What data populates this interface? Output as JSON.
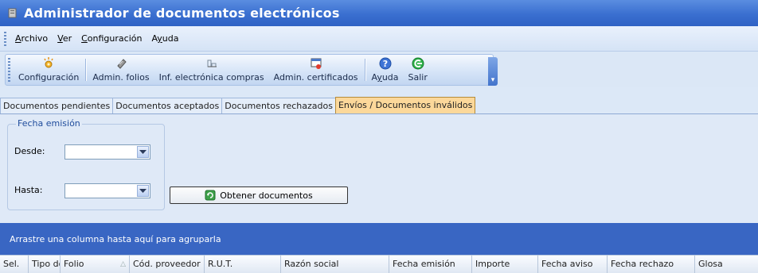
{
  "window": {
    "title": "Administrador de documentos electrónicos",
    "icon": "document-manager-icon"
  },
  "menu": [
    {
      "pre": "",
      "u": "A",
      "post": "rchivo"
    },
    {
      "pre": "",
      "u": "V",
      "post": "er"
    },
    {
      "pre": "",
      "u": "C",
      "post": "onfiguración"
    },
    {
      "pre": "A",
      "u": "y",
      "post": "uda"
    }
  ],
  "toolbar": {
    "configuracion": {
      "label": "Configuración",
      "icon": "gear-sparkle-icon"
    },
    "admin_folios": {
      "label": "Admin. folios",
      "icon": "stamp-icon"
    },
    "inf_electronica": {
      "label": "Inf. electrónica compras",
      "icon": "report-icon"
    },
    "admin_certificados": {
      "label": "Admin. certificados",
      "icon": "certificate-icon"
    },
    "ayuda": {
      "pre": "A",
      "u": "y",
      "post": "uda",
      "icon": "help-icon"
    },
    "salir": {
      "label": "Salir",
      "icon": "exit-icon"
    },
    "overflow_icon": "chevron-down-icon"
  },
  "tabs": [
    {
      "label": "Documentos pendientes",
      "active": false
    },
    {
      "label": "Documentos aceptados",
      "active": false
    },
    {
      "label": "Documentos rechazados",
      "active": false
    },
    {
      "label": "Envíos / Documentos inválidos",
      "active": true
    }
  ],
  "filter": {
    "legend": "Fecha emisión",
    "desde_label": "Desde:",
    "desde_value": "",
    "hasta_label": "Hasta:",
    "hasta_value": "",
    "obtener_label": "Obtener documentos",
    "obtener_icon": "refresh-icon"
  },
  "grid": {
    "group_prompt": "Arrastre una columna hasta aquí para agruparla",
    "columns": [
      "Sel.",
      "Tipo doc",
      "Folio",
      "Cód. proveedor",
      "R.U.T.",
      "Razón social",
      "Fecha emisión",
      "Importe",
      "Fecha aviso",
      "Fecha rechazo",
      "Glosa"
    ]
  },
  "colors": {
    "titlebar": "#3a6fd0",
    "active_tab": "#fcd89a",
    "group_area": "#3966c3"
  }
}
